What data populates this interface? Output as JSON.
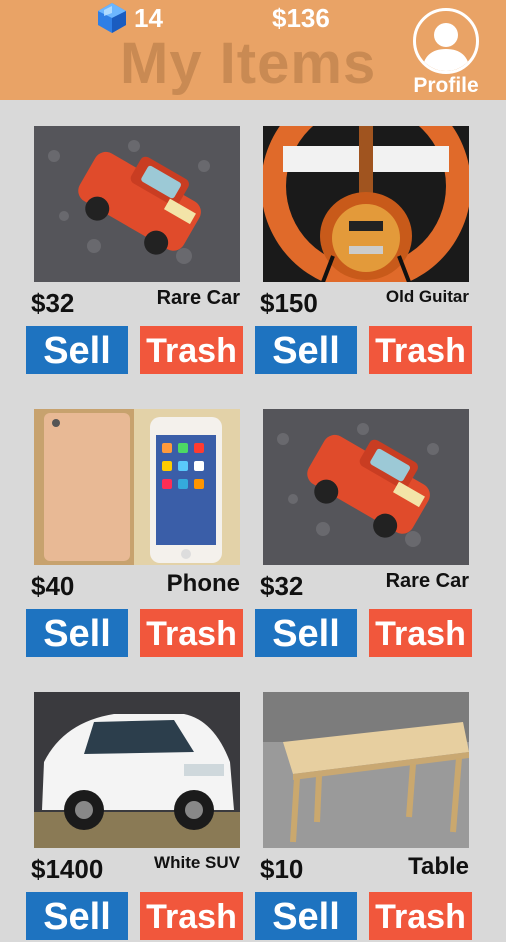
{
  "header": {
    "gems": "14",
    "money": "$136",
    "title": "My Items",
    "profile_label": "Profile"
  },
  "buttons": {
    "sell": "Sell",
    "trash": "Trash"
  },
  "items": [
    {
      "price": "$32",
      "name": "Rare Car",
      "image": "red-toy-car"
    },
    {
      "price": "$150",
      "name": "Old Guitar",
      "image": "sunburst-guitar"
    },
    {
      "price": "$40",
      "name": "Phone",
      "image": "smartphone-box"
    },
    {
      "price": "$32",
      "name": "Rare Car",
      "image": "red-toy-car"
    },
    {
      "price": "$1400",
      "name": "White SUV",
      "image": "white-suv"
    },
    {
      "price": "$10",
      "name": "Table",
      "image": "wooden-table"
    }
  ]
}
